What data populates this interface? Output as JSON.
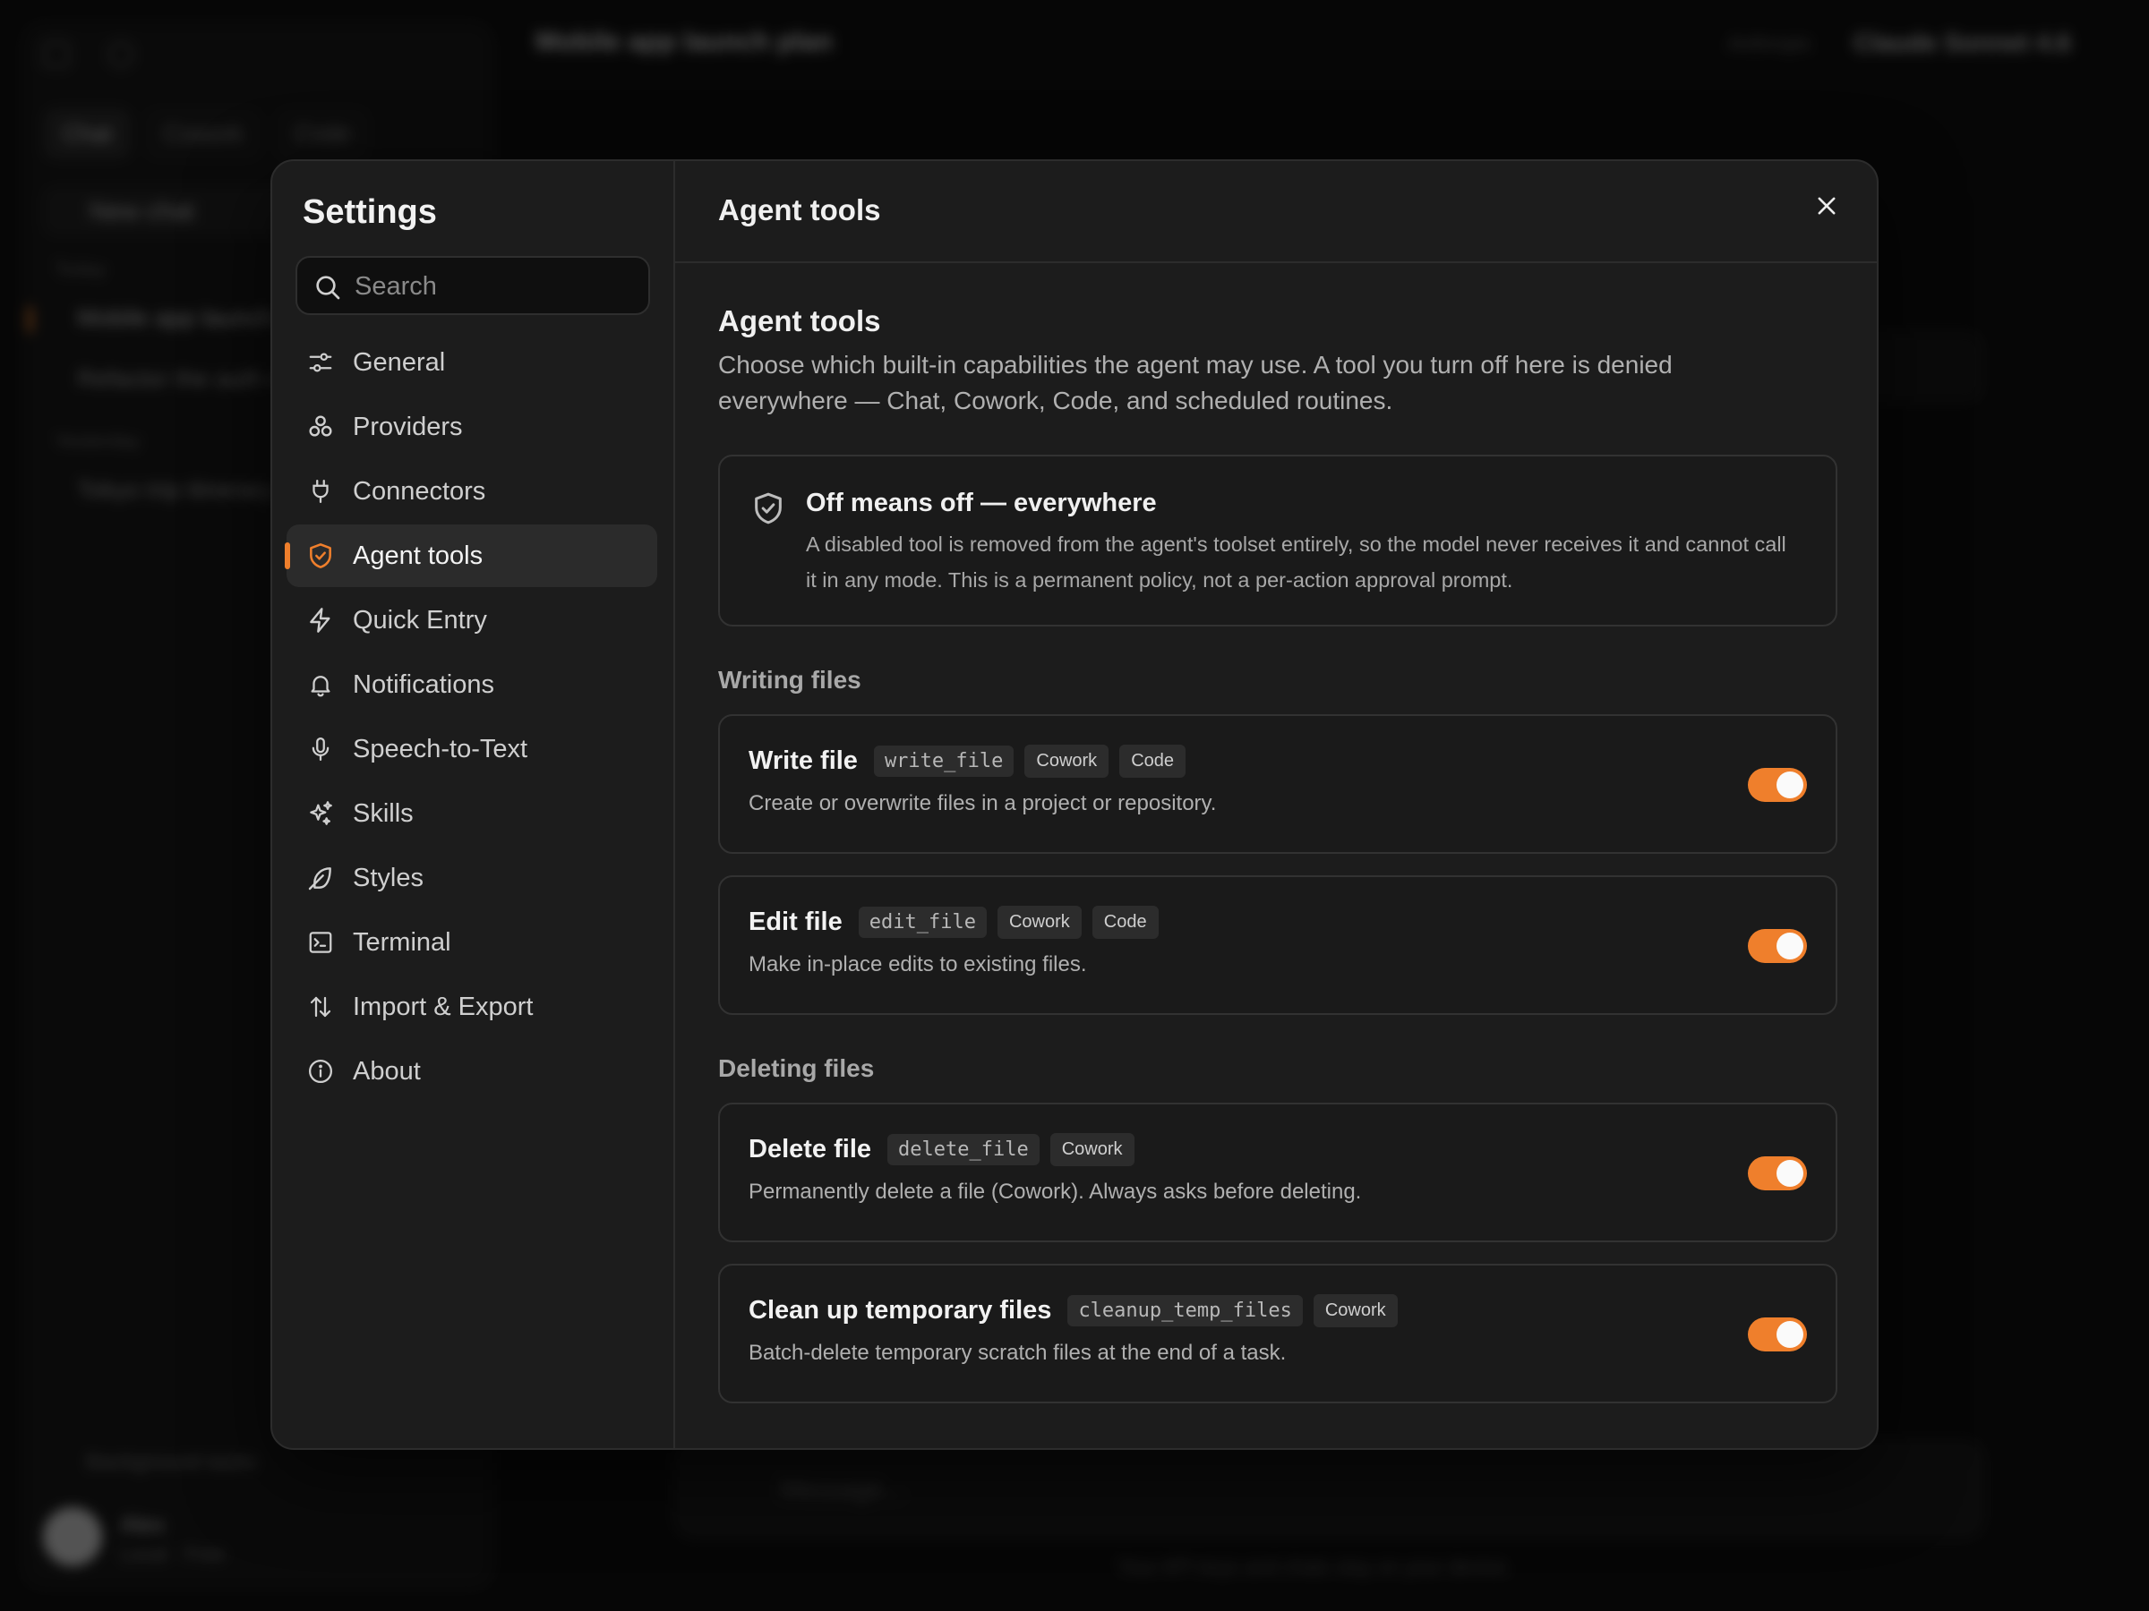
{
  "background": {
    "window_title": "Mobile app launch plan",
    "modes": [
      "Chat",
      "Cowork",
      "Code"
    ],
    "new_chat": "New chat",
    "sections": [
      {
        "label": "Today",
        "chats": [
          "Mobile app launch plan",
          "Refactor the auth module"
        ]
      },
      {
        "label": "Yesterday",
        "chats": [
          "Tokyo trip itinerary"
        ]
      }
    ],
    "background_tasks": "Background tasks",
    "user_name": "Alex",
    "user_plan": "Local · Free",
    "model_provider": "Anthropic",
    "model_name": "Claude Sonnet 4.6",
    "composer_placeholder": "Message...",
    "footer": "Your API keys and chats stay on your device."
  },
  "settings": {
    "title": "Settings",
    "search_placeholder": "Search",
    "nav": [
      {
        "label": "General",
        "icon": "sliders-icon"
      },
      {
        "label": "Providers",
        "icon": "providers-icon"
      },
      {
        "label": "Connectors",
        "icon": "plug-icon"
      },
      {
        "label": "Agent tools",
        "icon": "shield-icon",
        "active": true
      },
      {
        "label": "Quick Entry",
        "icon": "lightning-icon"
      },
      {
        "label": "Notifications",
        "icon": "bell-icon"
      },
      {
        "label": "Speech-to-Text",
        "icon": "microphone-icon"
      },
      {
        "label": "Skills",
        "icon": "sparkles-icon"
      },
      {
        "label": "Styles",
        "icon": "feather-icon"
      },
      {
        "label": "Terminal",
        "icon": "terminal-icon"
      },
      {
        "label": "Import & Export",
        "icon": "arrows-up-down-icon"
      },
      {
        "label": "About",
        "icon": "info-icon"
      }
    ]
  },
  "page": {
    "header_title": "Agent tools",
    "section_title": "Agent tools",
    "section_desc": "Choose which built-in capabilities the agent may use. A tool you turn off here is denied everywhere — Chat, Cowork, Code, and scheduled routines.",
    "notice_title": "Off means off — everywhere",
    "notice_body": "A disabled tool is removed from the agent's toolset entirely, so the model never receives it and cannot call it in any mode. This is a permanent policy, not a per-action approval prompt.",
    "groups": [
      {
        "title": "Writing files",
        "tools": [
          {
            "name": "Write file",
            "id": "write_file",
            "tags": [
              "Cowork",
              "Code"
            ],
            "desc": "Create or overwrite files in a project or repository.",
            "enabled": true
          },
          {
            "name": "Edit file",
            "id": "edit_file",
            "tags": [
              "Cowork",
              "Code"
            ],
            "desc": "Make in-place edits to existing files.",
            "enabled": true
          }
        ]
      },
      {
        "title": "Deleting files",
        "tools": [
          {
            "name": "Delete file",
            "id": "delete_file",
            "tags": [
              "Cowork"
            ],
            "desc": "Permanently delete a file (Cowork). Always asks before deleting.",
            "enabled": true
          },
          {
            "name": "Clean up temporary files",
            "id": "cleanup_temp_files",
            "tags": [
              "Cowork"
            ],
            "desc": "Batch-delete temporary scratch files at the end of a task.",
            "enabled": true
          }
        ]
      }
    ]
  },
  "colors": {
    "accent": "#ef7f2c",
    "modal_bg": "#1c1c1c",
    "page_bg": "#0c0c0c"
  }
}
